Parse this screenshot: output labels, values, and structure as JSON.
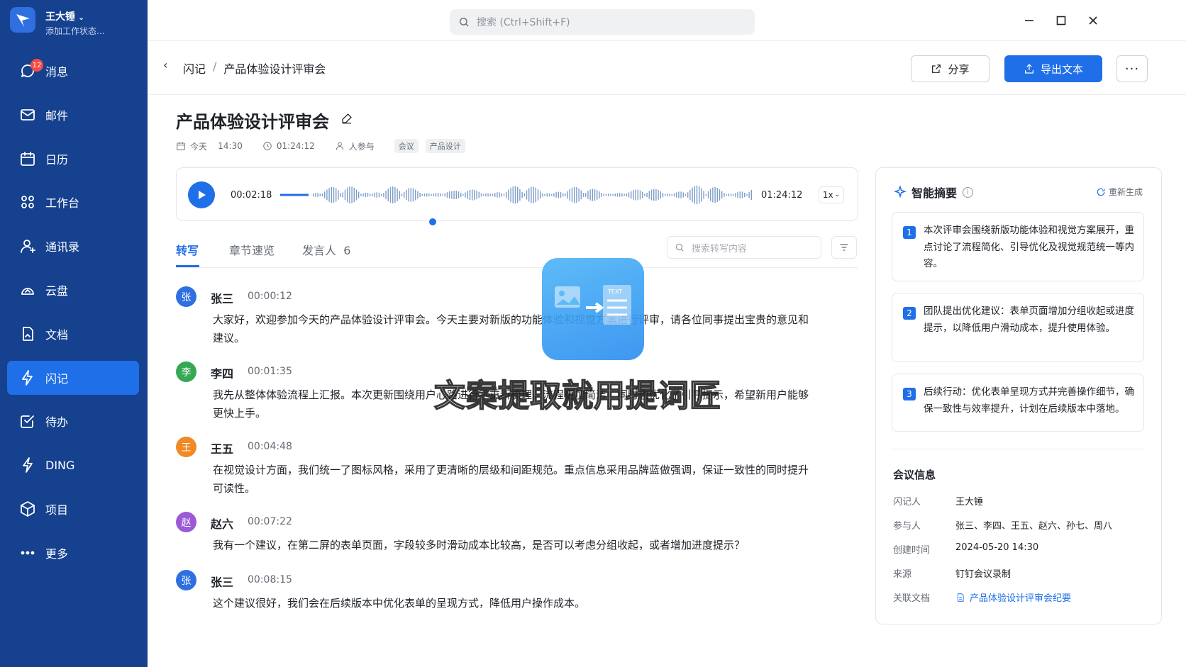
{
  "sidebar": {
    "user_name": "王大锤",
    "user_status": "添加工作状态...",
    "badge_count": "12",
    "items": [
      {
        "label": "消息",
        "icon": "chat-icon"
      },
      {
        "label": "邮件",
        "icon": "mail-icon"
      },
      {
        "label": "日历",
        "icon": "calendar-icon"
      },
      {
        "label": "工作台",
        "icon": "grid-icon"
      },
      {
        "label": "通讯录",
        "icon": "contacts-icon"
      },
      {
        "label": "云盘",
        "icon": "cloud-icon"
      },
      {
        "label": "文档",
        "icon": "document-icon"
      },
      {
        "label": "闪记",
        "icon": "flash-icon"
      },
      {
        "label": "待办",
        "icon": "todo-icon"
      },
      {
        "label": "DING",
        "icon": "ding-icon"
      },
      {
        "label": "项目",
        "icon": "cube-icon"
      },
      {
        "label": "更多",
        "icon": "more-icon"
      }
    ],
    "active_index": 7
  },
  "topbar": {
    "search_placeholder": "搜索 (Ctrl+Shift+F)"
  },
  "header": {
    "breadcrumb_root": "闪记",
    "breadcrumb_sep": "/",
    "breadcrumb_current": "产品体验设计评审会",
    "share_label": "分享",
    "export_label": "导出文本",
    "more_label": "···"
  },
  "meeting": {
    "title": "产品体验设计评审会",
    "date": "今天",
    "time": "14:30",
    "duration": "01:24:12",
    "participants": "人参与",
    "tags": [
      "会议",
      "产品设计"
    ]
  },
  "player": {
    "current": "00:02:18",
    "total": "01:24:12",
    "speed": "1x",
    "progress": 0.027
  },
  "tabs": {
    "transcript": "转写",
    "chapters": "章节速览",
    "speakers": "发言人",
    "speaker_count": "6",
    "search_placeholder": "搜索转写内容"
  },
  "transcript": [
    {
      "avatar": "张",
      "color": "#2f6fe0",
      "name": "张三",
      "time": "00:00:12",
      "text": "大家好，欢迎参加今天的产品体验设计评审会。今天主要对新版的功能体验和视觉方案进行评审，请各位同事提出宝贵的意见和建议。"
    },
    {
      "avatar": "李",
      "color": "#34a853",
      "name": "李四",
      "time": "00:01:35",
      "text": "我先从整体体验流程上汇报。本次更新围绕用户心路进行了重新梳理，流程更加简洁，同时也优化了引导提示，希望新用户能够更快上手。"
    },
    {
      "avatar": "王",
      "color": "#f08a24",
      "name": "王五",
      "time": "00:04:48",
      "text": "在视觉设计方面，我们统一了图标风格，采用了更清晰的层级和间距规范。重点信息采用品牌蓝做强调，保证一致性的同时提升可读性。"
    },
    {
      "avatar": "赵",
      "color": "#9b59d6",
      "name": "赵六",
      "time": "00:07:22",
      "text": "我有一个建议，在第二屏的表单页面，字段较多时滑动成本比较高，是否可以考虑分组收起，或者增加进度提示？"
    },
    {
      "avatar": "张",
      "color": "#2f6fe0",
      "name": "张三",
      "time": "00:08:15",
      "text": "这个建议很好，我们会在后续版本中优化表单的呈现方式，降低用户操作成本。"
    }
  ],
  "overlay": {
    "watermark_text": "文案提取就用提词匠",
    "badge_word": "TEXT"
  },
  "summary": {
    "title": "智能摘要",
    "info": "i",
    "regenerate": "重新生成",
    "points": [
      {
        "num": "1",
        "text": "本次评审会围绕新版功能体验和视觉方案展开，重点讨论了流程简化、引导优化及视觉规范统一等内容。"
      },
      {
        "num": "2",
        "text": "团队提出优化建议：表单页面增加分组收起或进度提示，以降低用户滑动成本，提升使用体验。"
      },
      {
        "num": "3",
        "text": "后续行动：优化表单呈现方式并完善操作细节，确保一致性与效率提升，计划在后续版本中落地。"
      }
    ]
  },
  "meeting_info": {
    "title": "会议信息",
    "rows": [
      {
        "key": "闪记人",
        "value": "王大锤"
      },
      {
        "key": "参与人",
        "value": "张三、李四、王五、赵六、孙七、周八"
      },
      {
        "key": "创建时间",
        "value": "2024-05-20 14:30"
      },
      {
        "key": "来源",
        "value": "钉钉会议录制"
      },
      {
        "key": "关联文档",
        "value": "产品体验设计评审会纪要"
      }
    ]
  },
  "colors": {
    "sidebar": "#15418f",
    "accent": "#1f6fe8"
  }
}
